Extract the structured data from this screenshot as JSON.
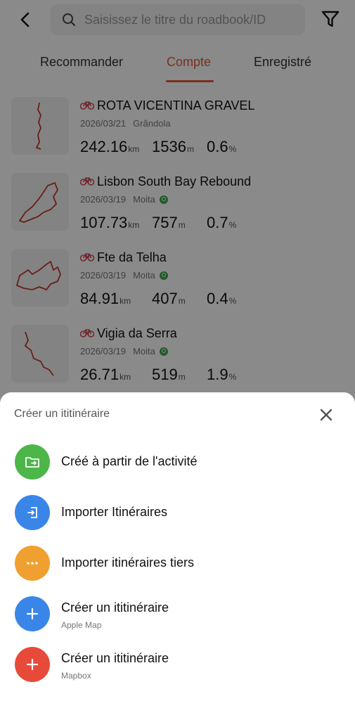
{
  "header": {
    "search_placeholder": "Saisissez le titre du roadbook/ID"
  },
  "tabs": [
    {
      "label": "Recommander",
      "active": false
    },
    {
      "label": "Compte",
      "active": true
    },
    {
      "label": "Enregistré",
      "active": false
    }
  ],
  "routes": [
    {
      "title": "ROTA VICENTINA GRAVEL",
      "date": "2026/03/21",
      "location": "Grândola",
      "synced": false,
      "distance": "242.16",
      "distance_unit": "km",
      "elevation": "1536",
      "elevation_unit": "m",
      "grade": "0.6",
      "grade_unit": "%"
    },
    {
      "title": "Lisbon South Bay Rebound",
      "date": "2026/03/19",
      "location": "Moita",
      "synced": true,
      "distance": "107.73",
      "distance_unit": "km",
      "elevation": "757",
      "elevation_unit": "m",
      "grade": "0.7",
      "grade_unit": "%"
    },
    {
      "title": "Fte da Telha",
      "date": "2026/03/19",
      "location": "Moita",
      "synced": true,
      "distance": "84.91",
      "distance_unit": "km",
      "elevation": "407",
      "elevation_unit": "m",
      "grade": "0.4",
      "grade_unit": "%"
    },
    {
      "title": "Vigia da Serra",
      "date": "2026/03/19",
      "location": "Moita",
      "synced": true,
      "distance": "26.71",
      "distance_unit": "km",
      "elevation": "519",
      "elevation_unit": "m",
      "grade": "1.9",
      "grade_unit": "%"
    }
  ],
  "sheet": {
    "title": "Créer un ititinéraire",
    "options": [
      {
        "label": "Créé à partir de l'activité",
        "sub": "",
        "color": "#4cb648",
        "icon": "folder-import-icon"
      },
      {
        "label": "Importer Itinéraires",
        "sub": "",
        "color": "#3a86e8",
        "icon": "import-icon"
      },
      {
        "label": "Importer itinéraires tiers",
        "sub": "",
        "color": "#f0a030",
        "icon": "more-icon"
      },
      {
        "label": "Créer un ititinéraire",
        "sub": "Apple Map",
        "color": "#3a86e8",
        "icon": "plus-icon"
      },
      {
        "label": "Créer un ititinéraire",
        "sub": "Mapbox",
        "color": "#e84a3a",
        "icon": "plus-icon"
      }
    ]
  },
  "colors": {
    "accent": "#e25a3a"
  }
}
